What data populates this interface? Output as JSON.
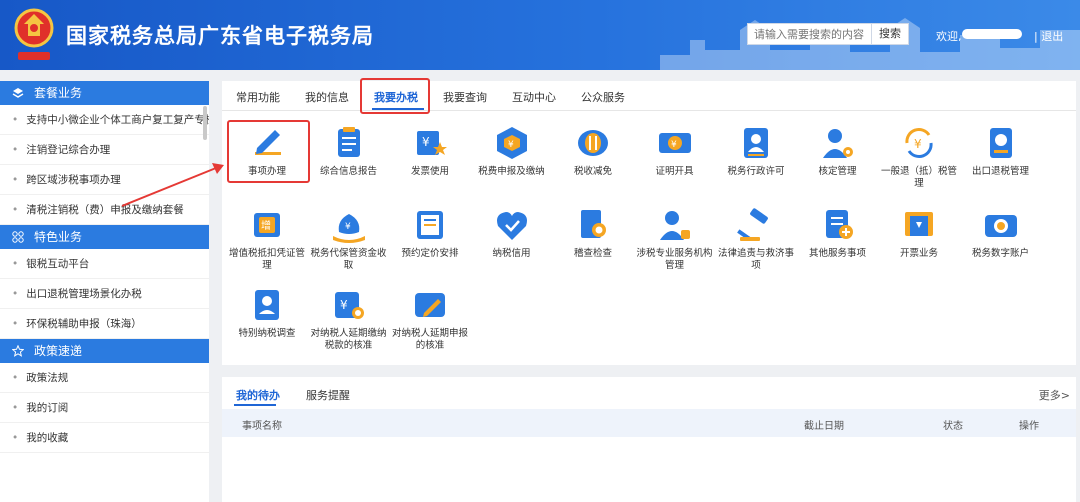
{
  "header": {
    "title": "国家税务总局广东省电子税务局",
    "search_placeholder": "请输入需要搜索的内容",
    "search_button": "搜索",
    "welcome": "欢迎,",
    "logout": "| 退出"
  },
  "sidebar": {
    "sections": [
      {
        "title": "套餐业务",
        "icon": "layers-icon",
        "items": [
          "支持中小微企业个体工商户复工复产专栏",
          "注销登记综合办理",
          "跨区域涉税事项办理",
          "清税注销税（费）申报及缴纳套餐"
        ]
      },
      {
        "title": "特色业务",
        "icon": "grid-icon",
        "items": [
          "银税互动平台",
          "出口退税管理场景化办税",
          "环保税辅助申报（珠海）"
        ]
      },
      {
        "title": "政策速递",
        "icon": "star-icon",
        "items": [
          "政策法规",
          "我的订阅",
          "我的收藏"
        ]
      }
    ]
  },
  "main": {
    "tabs": [
      "常用功能",
      "我的信息",
      "我要办税",
      "我要查询",
      "互动中心",
      "公众服务"
    ],
    "active_tab": "我要办税",
    "items": [
      {
        "label": "事项办理",
        "icon": "pencil-icon"
      },
      {
        "label": "综合信息报告",
        "icon": "document-list-icon"
      },
      {
        "label": "发票使用",
        "icon": "invoice-star-icon"
      },
      {
        "label": "税费申报及缴纳",
        "icon": "yuan-cube-icon"
      },
      {
        "label": "税收减免",
        "icon": "coins-icon"
      },
      {
        "label": "证明开具",
        "icon": "yuan-ticket-icon"
      },
      {
        "label": "税务行政许可",
        "icon": "person-card-icon"
      },
      {
        "label": "核定管理",
        "icon": "person-gear-icon"
      },
      {
        "label": "一般退（抵）税管理",
        "icon": "yuan-refresh-icon"
      },
      {
        "label": "出口退税管理",
        "icon": "passport-icon"
      },
      {
        "label": "增值税抵扣凭证管理",
        "icon": "vat-chip-icon"
      },
      {
        "label": "税务代保管资金收取",
        "icon": "money-bag-icon"
      },
      {
        "label": "预约定价安排",
        "icon": "contract-icon"
      },
      {
        "label": "纳税信用",
        "icon": "credit-heart-icon"
      },
      {
        "label": "稽查检查",
        "icon": "inspect-doc-icon"
      },
      {
        "label": "涉税专业服务机构管理",
        "icon": "agency-person-icon"
      },
      {
        "label": "法律追责与救济事项",
        "icon": "gavel-icon"
      },
      {
        "label": "其他服务事项",
        "icon": "checklist-plus-icon"
      },
      {
        "label": "开票业务",
        "icon": "receipt-icon"
      },
      {
        "label": "税务数字账户",
        "icon": "digital-account-icon"
      },
      {
        "label": "特别纳税调查",
        "icon": "id-card-icon"
      },
      {
        "label": "对纳税人延期缴纳税款的核准",
        "icon": "yuan-search-icon"
      },
      {
        "label": "对纳税人延期申报的核准",
        "icon": "edit-card-icon"
      }
    ]
  },
  "pending": {
    "tabs": [
      "我的待办",
      "服务提醒"
    ],
    "more": "更多>",
    "columns": [
      "事项名称",
      "截止日期",
      "状态",
      "操作"
    ]
  },
  "colors": {
    "primary": "#2b7be0",
    "highlight": "#e53935",
    "icon_blue": "#2b7be0",
    "icon_orange": "#f5a623"
  }
}
